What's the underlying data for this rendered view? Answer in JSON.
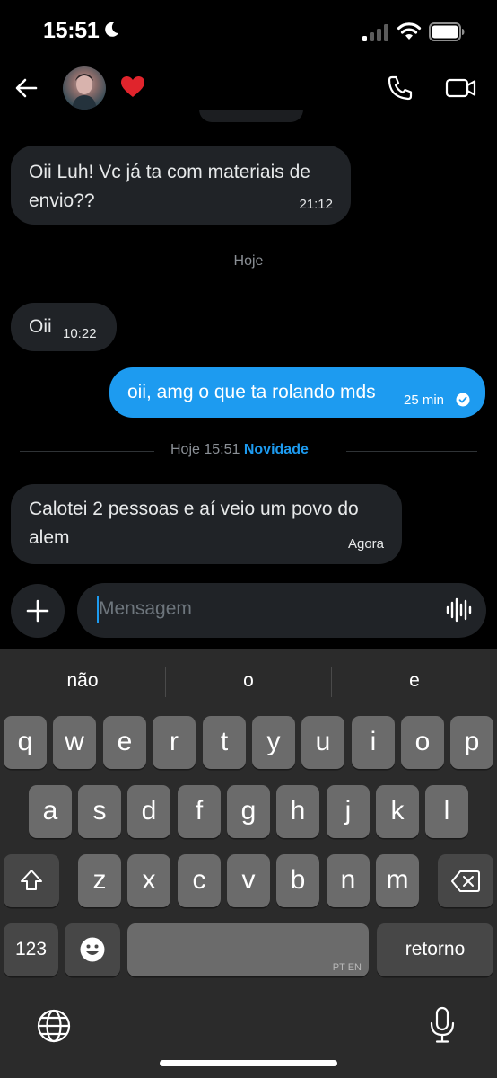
{
  "status_bar": {
    "time": "15:51"
  },
  "header": {
    "heart": "❤️"
  },
  "messages": [
    {
      "text": "Oii Luh! Vc já ta com materiais de envio??",
      "time": "21:12",
      "direction": "in"
    },
    {
      "text": "Oii",
      "time": "10:22",
      "direction": "in"
    },
    {
      "text": "oii, amg o que ta rolando mds",
      "time": "25 min",
      "direction": "out",
      "status": "read"
    },
    {
      "text": "Calotei 2 pessoas e aí veio um povo do alem",
      "time": "Agora",
      "direction": "in"
    }
  ],
  "day_label": "Hoje",
  "divider": {
    "time": "Hoje 15:51",
    "new_label": "Novidade"
  },
  "composer": {
    "placeholder": "Mensagem"
  },
  "keyboard": {
    "suggestions": [
      "não",
      "o",
      "e"
    ],
    "row1": [
      "q",
      "w",
      "e",
      "r",
      "t",
      "y",
      "u",
      "i",
      "o",
      "p"
    ],
    "row2": [
      "a",
      "s",
      "d",
      "f",
      "g",
      "h",
      "j",
      "k",
      "l"
    ],
    "row3": [
      "z",
      "x",
      "c",
      "v",
      "b",
      "n",
      "m"
    ],
    "numbers_label": "123",
    "space_lang": "PT EN",
    "return_label": "retorno"
  },
  "colors": {
    "accent": "#1d9bf0",
    "bubble_in": "#202327",
    "background": "#000000",
    "keyboard_bg": "#2b2b2b",
    "key": "#6b6b6b",
    "key_dark": "#474747"
  }
}
